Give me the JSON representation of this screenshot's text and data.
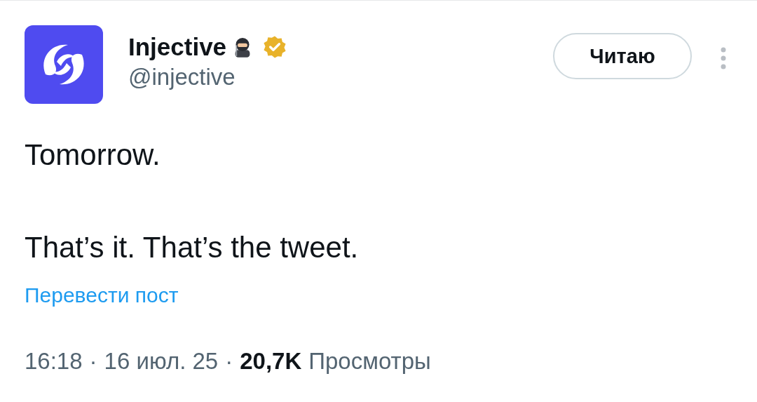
{
  "author": {
    "name": "Injective",
    "handle": "@injective",
    "verified": true
  },
  "follow_button": {
    "label": "Читаю"
  },
  "post": {
    "text": "Tomorrow.\n\nThat’s it. That’s the tweet."
  },
  "translate_link": "Перевести пост",
  "meta": {
    "time": "16:18",
    "separators": [
      "·",
      "·"
    ],
    "date": "16 июл. 25",
    "views_count": "20,7K",
    "views_label": "Просмотры"
  }
}
